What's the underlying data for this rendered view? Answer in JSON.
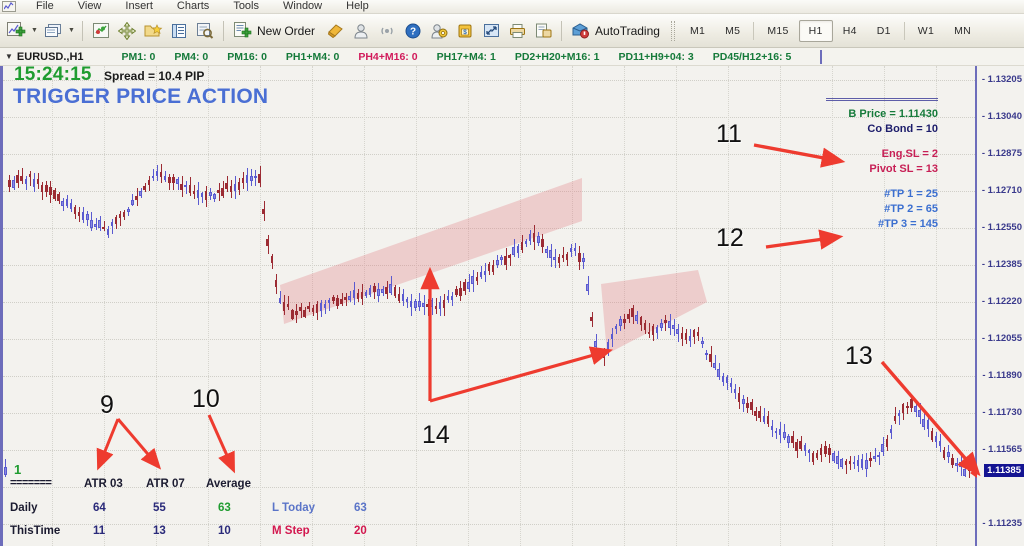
{
  "menu": {
    "logo_icon": "mt-chart-logo-icon",
    "items": [
      "File",
      "View",
      "Insert",
      "Charts",
      "Tools",
      "Window",
      "Help"
    ]
  },
  "toolbar": {
    "new_chart_icon": "new-chart-icon",
    "profiles_icon": "profiles-icon",
    "market_watch_icon": "market-watch-icon",
    "navigator_icon": "navigator-icon",
    "data_window_icon": "data-window-icon",
    "terminal_icon": "terminal-icon",
    "strategy_tester_icon": "strategy-tester-icon",
    "new_order_icon": "new-order-icon",
    "new_order_label": "New Order",
    "metaeditor_icon": "metaeditor-icon",
    "expert_advisors_icon": "expert-advisors-icon",
    "signals_icon": "signals-icon",
    "help_icon": "help-question-icon",
    "options_icon": "options-gear-icon",
    "market_icon": "market-store-icon",
    "fullscreen_icon": "fullscreen-icon",
    "print_icon": "print-icon",
    "print_preview_icon": "print-preview-icon",
    "autotrading_icon": "autotrading-icon",
    "autotrading_label": "AutoTrading",
    "timeframes": [
      {
        "label": "M1",
        "active": false
      },
      {
        "label": "M5",
        "active": false
      },
      {
        "label": "M15",
        "active": false
      },
      {
        "label": "H1",
        "active": true
      },
      {
        "label": "H4",
        "active": false
      },
      {
        "label": "D1",
        "active": false
      },
      {
        "label": "W1",
        "active": false
      },
      {
        "label": "MN",
        "active": false
      }
    ]
  },
  "symbolbar": {
    "caret_icon": "chevron-down-icon",
    "symbol": "EURUSD.,H1",
    "counters": [
      {
        "label": "PM1: 0",
        "color": "green"
      },
      {
        "label": "PM4: 0",
        "color": "green"
      },
      {
        "label": "PM16: 0",
        "color": "green"
      },
      {
        "label": "PH1+M4: 0",
        "color": "green"
      },
      {
        "label": "PH4+M16: 0",
        "color": "red"
      },
      {
        "label": "PH17+M4: 1",
        "color": "green"
      },
      {
        "label": "PD2+H20+M16: 1",
        "color": "green"
      },
      {
        "label": "PD11+H9+04: 3",
        "color": "green"
      },
      {
        "label": "PD45/H12+16: 5",
        "color": "green"
      }
    ]
  },
  "chart": {
    "clock": "15:24:15",
    "spread": "Spread = 10.4 PIP",
    "brand": "TRIGGER PRICE ACTION",
    "info_panel": {
      "b_price": "B Price  = 1.11430",
      "co_bond": "Co Bond = 10",
      "eng_sl": "Eng.SL = 2",
      "pivot_sl": "Pivot SL = 13",
      "tp1": "#TP 1 = 25",
      "tp2": "#TP 2 = 65",
      "tp3": "#TP 3 = 145"
    },
    "price_axis": {
      "ticks": [
        "1.13205",
        "1.13040",
        "1.12875",
        "1.12710",
        "1.12550",
        "1.12385",
        "1.12220",
        "1.12055",
        "1.11890",
        "1.11730",
        "1.11565",
        "1.11235"
      ],
      "current_price": "1.11385"
    },
    "annotations": [
      {
        "id": "9",
        "label": "9"
      },
      {
        "id": "10",
        "label": "10"
      },
      {
        "id": "11",
        "label": "11"
      },
      {
        "id": "12",
        "label": "12"
      },
      {
        "id": "13",
        "label": "13"
      },
      {
        "id": "14",
        "label": "14"
      }
    ]
  },
  "atr_table": {
    "marker": "1",
    "dashes": "=======",
    "headers": [
      "ATR 03",
      "ATR 07",
      "Average"
    ],
    "rows": [
      {
        "name": "Daily",
        "atr03": "64",
        "atr07": "55",
        "average": "63",
        "extra_label": "L Today",
        "extra_value": "63"
      },
      {
        "name": "ThisTime",
        "atr03": "11",
        "atr07": "13",
        "average": "10",
        "extra_label": "M Step",
        "extra_value": "20"
      }
    ]
  },
  "chart_data": {
    "type": "candlestick",
    "title": "EURUSD.,H1",
    "bull_color": "#5a5ad0",
    "bear_color": "#9c2b33",
    "ylim": [
      1.1115,
      1.1329
    ],
    "current_price": 1.11385,
    "yticks": [
      1.13205,
      1.1304,
      1.12875,
      1.1271,
      1.1255,
      1.12385,
      1.1222,
      1.12055,
      1.1189,
      1.1173,
      1.11565,
      1.11235
    ],
    "channels": [
      {
        "name": "rising-channel",
        "direction": "up",
        "color": "#e2787d",
        "opacity": 0.3
      },
      {
        "name": "falling-channel",
        "direction": "down",
        "color": "#e2787d",
        "opacity": 0.3
      }
    ]
  }
}
